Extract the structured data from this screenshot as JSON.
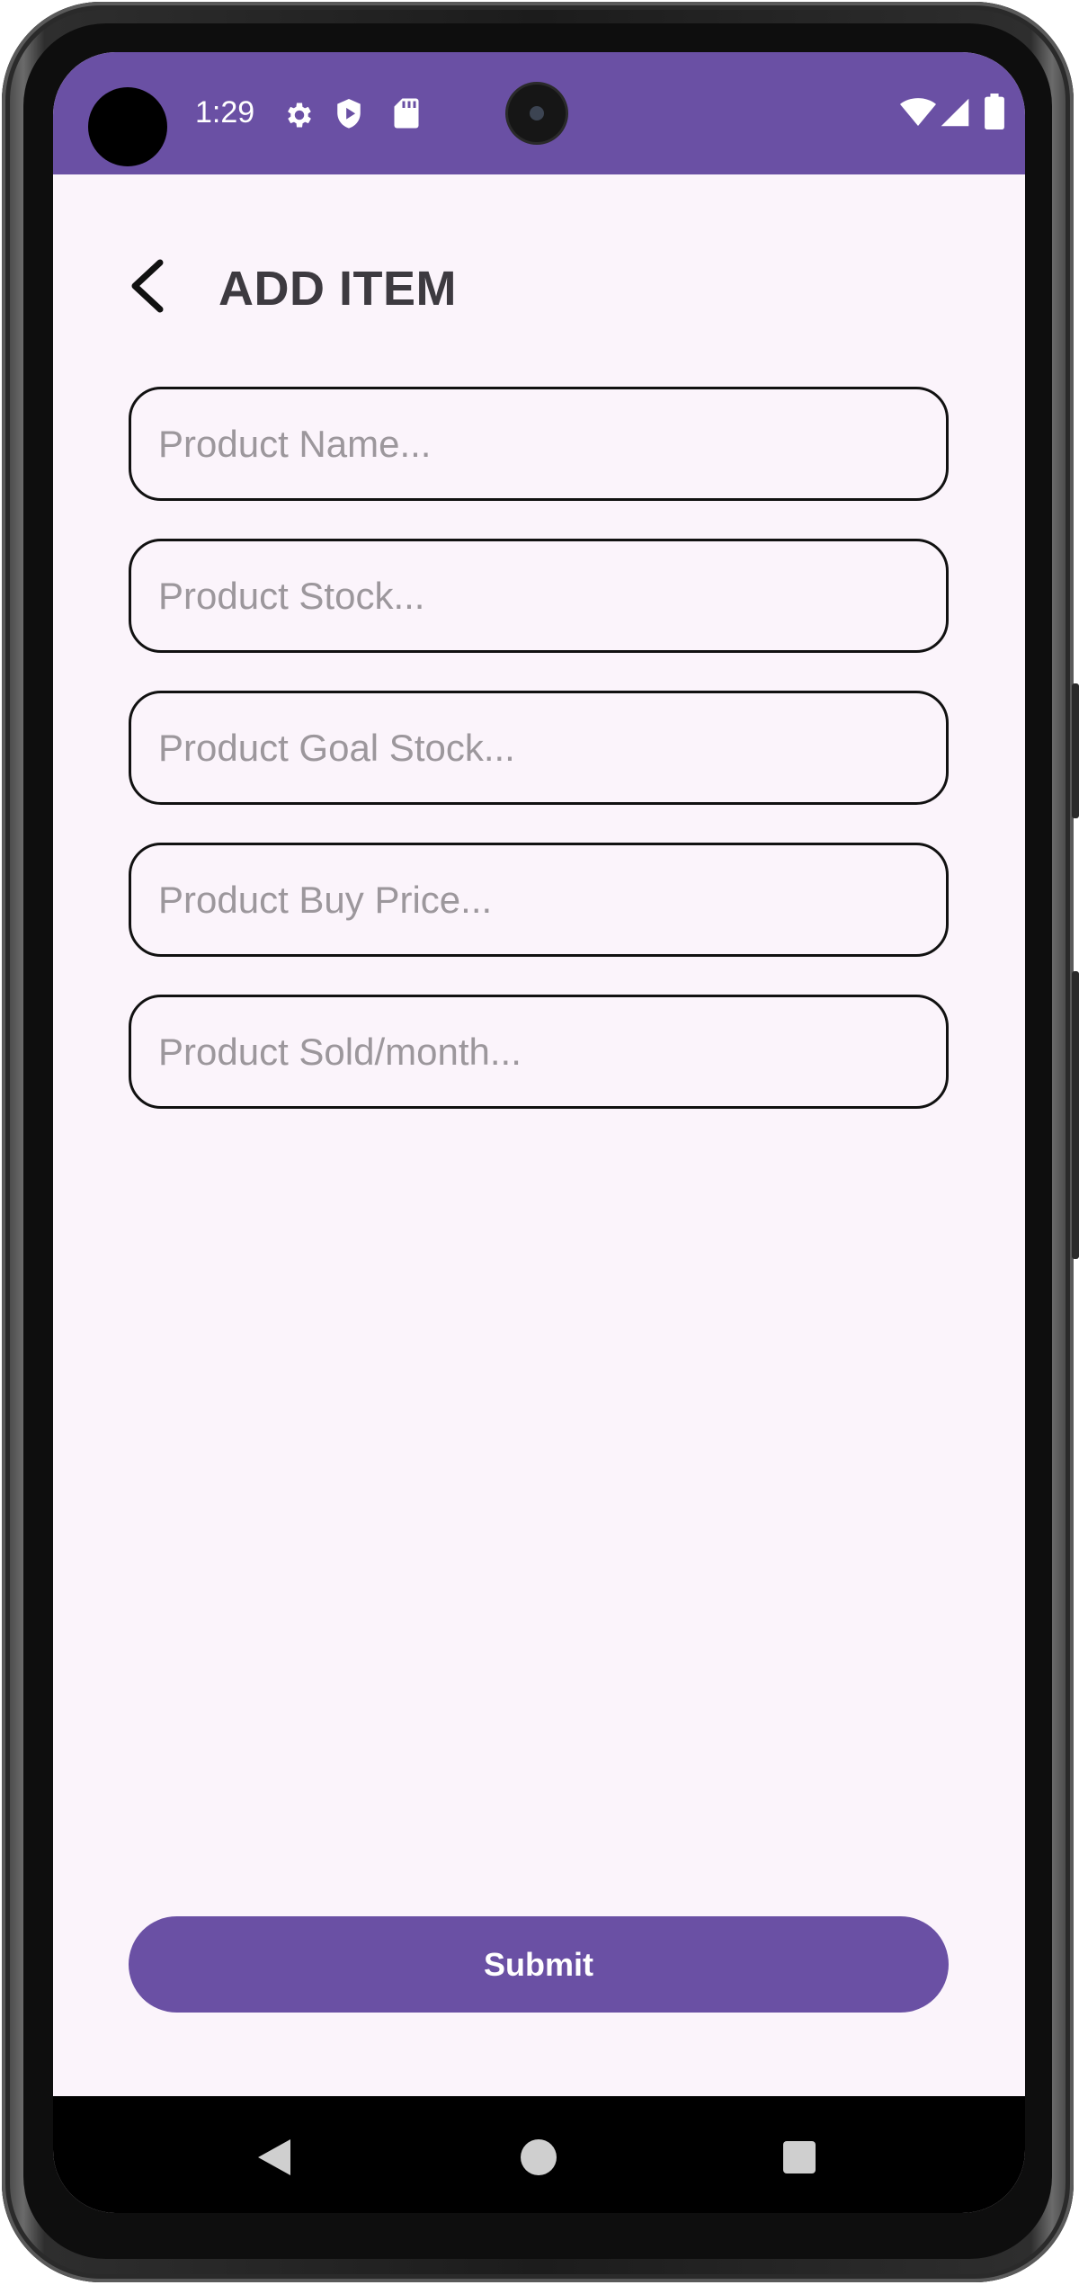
{
  "status_bar": {
    "time": "1:29",
    "icons": [
      "gear-icon",
      "shield-play-icon",
      "sd-card-icon",
      "wifi-icon",
      "signal-icon",
      "battery-icon"
    ]
  },
  "header": {
    "title": "ADD ITEM",
    "back_icon": "back-arrow-icon"
  },
  "form": {
    "fields": [
      {
        "name": "product-name",
        "placeholder": "Product Name...",
        "value": ""
      },
      {
        "name": "product-stock",
        "placeholder": "Product Stock...",
        "value": ""
      },
      {
        "name": "product-goal-stock",
        "placeholder": "Product Goal Stock...",
        "value": ""
      },
      {
        "name": "product-buy-price",
        "placeholder": "Product Buy Price...",
        "value": ""
      },
      {
        "name": "product-sold-month",
        "placeholder": "Product Sold/month...",
        "value": ""
      }
    ],
    "submit_label": "Submit"
  },
  "nav_bar": {
    "buttons": [
      "nav-back-icon",
      "nav-home-icon",
      "nav-recents-icon"
    ]
  },
  "colors": {
    "primary": "#6a50a4",
    "background": "#fbf4fb",
    "title": "#3d3a40",
    "placeholder": "#9c979c",
    "field_border": "#111111"
  }
}
